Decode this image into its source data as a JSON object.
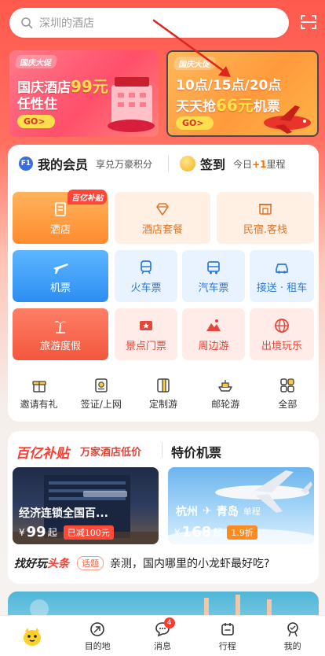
{
  "search": {
    "placeholder": "深圳的酒店"
  },
  "banners": [
    {
      "tag": "国庆大促",
      "line1_prefix": "国庆酒店",
      "line1_highlight": "99元",
      "line2": "任性住",
      "go": "GO>"
    },
    {
      "tag": "国庆大促",
      "line1": "10点/15点/20点",
      "line2_prefix": "天天抢",
      "line2_highlight": "66元",
      "line2_suffix": "机票",
      "go": "GO>"
    }
  ],
  "membership": {
    "badge": "F1",
    "title": "我的会员",
    "subtitle": "享兑万豪积分",
    "signin": "签到",
    "signin_sub_prefix": "今日",
    "signin_sub_bonus": "+1",
    "signin_sub_suffix": "里程"
  },
  "grid": {
    "hotel": {
      "label": "酒店",
      "badge": "百亿补贴"
    },
    "hotel_package": {
      "label": "酒店套餐"
    },
    "homestay": {
      "label": "民宿.客栈"
    },
    "flight": {
      "label": "机票"
    },
    "train": {
      "label": "火车票"
    },
    "bus": {
      "label": "汽车票"
    },
    "transfer": {
      "label": "接送 · 租车"
    },
    "vacation": {
      "label": "旅游度假"
    },
    "tickets": {
      "label": "景点门票"
    },
    "nearby": {
      "label": "周边游"
    },
    "outbound": {
      "label": "出境玩乐"
    }
  },
  "small_row": [
    {
      "label": "邀请有礼",
      "icon": "gift-icon"
    },
    {
      "label": "签证/上网",
      "icon": "visa-icon"
    },
    {
      "label": "定制游",
      "icon": "custom-tour-icon"
    },
    {
      "label": "邮轮游",
      "icon": "cruise-icon"
    },
    {
      "label": "全部",
      "icon": "grid-icon"
    }
  ],
  "deals": {
    "logo": "百亿补贴",
    "subtitle": "万家酒店低价",
    "flight_title": "特价机票",
    "hotel_card": {
      "title": "经济连锁全国百...",
      "currency": "¥",
      "price": "99",
      "unit": "起",
      "tag": "已减100元"
    },
    "flight_card": {
      "from": "杭州",
      "to": "青岛",
      "type": "单程",
      "currency": "¥",
      "price": "168",
      "unit": "起",
      "tag": "1.9折"
    }
  },
  "play": {
    "logo_a": "找好玩",
    "logo_b": "头条",
    "topic": "话题",
    "text": "亲测，国内哪里的小龙虾最好吃?"
  },
  "tabbar": [
    {
      "label": "",
      "icon": "fliggy-home-icon"
    },
    {
      "label": "目的地",
      "icon": "destination-icon"
    },
    {
      "label": "消息",
      "icon": "message-icon",
      "badge": "4"
    },
    {
      "label": "行程",
      "icon": "itinerary-icon"
    },
    {
      "label": "我的",
      "icon": "profile-icon"
    }
  ],
  "colors": {
    "brand": "#ff5a4e",
    "accent_orange": "#ff8b2e",
    "accent_blue": "#2c8ef2",
    "accent_red": "#f2573e"
  }
}
